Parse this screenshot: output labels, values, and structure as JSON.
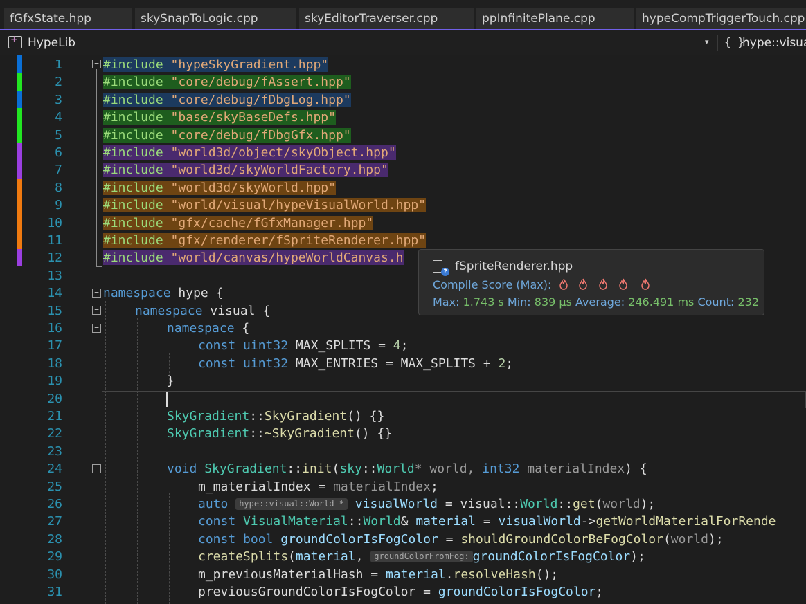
{
  "tabs": [
    {
      "label": "fGfxState.hpp"
    },
    {
      "label": "skySnapToLogic.cpp"
    },
    {
      "label": "skyEditorTraverser.cpp"
    },
    {
      "label": "ppInfinitePlane.cpp"
    },
    {
      "label": "hypeCompTriggerTouch.cpp"
    }
  ],
  "navbar": {
    "project": "HypeLib",
    "dropdown_glyph": "▾",
    "scope_icon": "{ }",
    "scope": "hype::visual"
  },
  "line_numbers": [
    "1",
    "2",
    "3",
    "4",
    "5",
    "6",
    "7",
    "8",
    "9",
    "10",
    "11",
    "12",
    "13",
    "14",
    "15",
    "16",
    "17",
    "18",
    "19",
    "20",
    "21",
    "22",
    "23",
    "24",
    "25",
    "26",
    "27",
    "28",
    "29",
    "30",
    "31"
  ],
  "code": {
    "include_kw": "#include",
    "namespace_kw": "namespace",
    "const_kw": "const",
    "includes": [
      "\"hypeSkyGradient.hpp\"",
      "\"core/debug/fAssert.hpp\"",
      "\"core/debug/fDbgLog.hpp\"",
      "\"base/skyBaseDefs.hpp\"",
      "\"core/debug/fDbgGfx.hpp\"",
      "\"world3d/object/skyObject.hpp\"",
      "\"world3d/skyWorldFactory.hpp\"",
      "\"world3d/skyWorld.hpp\"",
      "\"world/visual/hypeVisualWorld.hpp\"",
      "\"gfx/cache/fGfxManager.hpp\"",
      "\"gfx/renderer/fSpriteRenderer.hpp\"",
      "\"world/canvas/hypeWorldCanvas.h"
    ],
    "ns_hype": "hype",
    "ns_visual": "visual",
    "open_brace": " {",
    "close_brace": "}",
    "uint32": "uint32",
    "max_splits": "MAX_SPLITS",
    "max_entries": "MAX_ENTRIES",
    "eq": " = ",
    "four": "4",
    "two": "2",
    "plus": " + ",
    "semi": ";",
    "sky_gradient": "SkyGradient",
    "scope_op": "::",
    "ctor_tail": "() {}",
    "dtor_name": "~SkyGradient",
    "void_kw": "void",
    "init_fn": "init",
    "sky_ns": "sky",
    "world_ty": "World",
    "star_world": "* world, ",
    "int32": "int32",
    "material_index_param": "materialIndex",
    "close_paren_brace": ") {",
    "m_material_index": "m_materialIndex",
    "auto_kw": "auto",
    "hint_auto": "hype::visual::World *",
    "visual_world": "visualWorld",
    "visual_ns": "visual",
    "get_fn": "get",
    "world_param": "world",
    "visual_material": "VisualMaterial",
    "amp_space": "& ",
    "material": "material",
    "arrow": "->",
    "get_world_material": "getWorldMaterialForRende",
    "bool_kw": "bool",
    "ground_is_fog": "groundColorIsFogColor",
    "should_ground": "shouldGroundColorBeFogColor",
    "create_splits": "createSplits",
    "hint_ground": "groundColorFromFog:",
    "m_prev_hash": "m_previousMaterialHash",
    "resolve_hash": "resolveHash",
    "prev_ground": "previousGroundColorIsFogColor"
  },
  "tooltip": {
    "filename": "fSpriteRenderer.hpp",
    "score_label": "Compile Score (Max):",
    "flame_glyph": "🜂",
    "max_label": "Max:",
    "max_value": "1.743 s",
    "min_label": "Min:",
    "min_value": "839 µs",
    "avg_label": "Average:",
    "avg_value": "246.491 ms",
    "count_label": "Count:",
    "count_value": "232"
  },
  "colors": {
    "bar_blue": "#0a6fd6",
    "bar_green": "#22e522",
    "bar_purple": "#9b3fe0",
    "bar_orange": "#f07a10",
    "tab_accent": "#7160e8"
  }
}
